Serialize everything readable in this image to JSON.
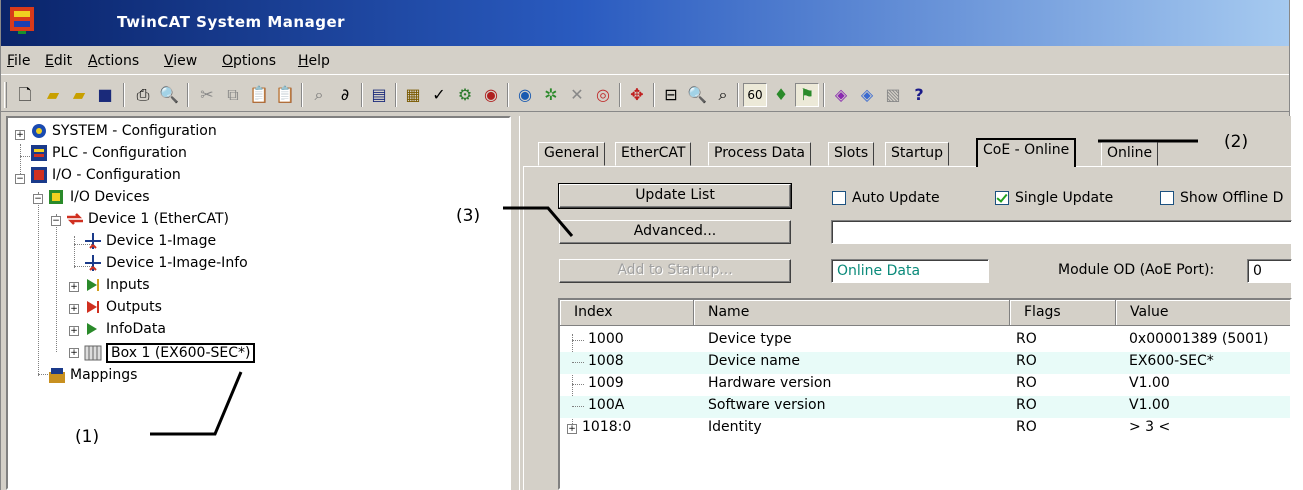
{
  "window": {
    "title": "TwinCAT System Manager"
  },
  "menu": [
    {
      "label": "File",
      "u": "F",
      "rest": "ile"
    },
    {
      "label": "Edit",
      "u": "E",
      "rest": "dit"
    },
    {
      "label": "Actions",
      "u": "A",
      "rest": "ctions"
    },
    {
      "label": "View",
      "u": "V",
      "rest": "iew"
    },
    {
      "label": "Options",
      "u": "O",
      "rest": "ptions"
    },
    {
      "label": "Help",
      "u": "H",
      "rest": "elp"
    }
  ],
  "tree": {
    "system": "SYSTEM - Configuration",
    "plc": "PLC - Configuration",
    "io": "I/O - Configuration",
    "io_devices": "I/O Devices",
    "device1": "Device 1 (EtherCAT)",
    "image": "Device 1-Image",
    "image_info": "Device 1-Image-Info",
    "inputs": "Inputs",
    "outputs": "Outputs",
    "infodata": "InfoData",
    "box1": "Box 1 (EX600-SEC*)",
    "mappings": "Mappings"
  },
  "tabs": [
    "General",
    "EtherCAT",
    "Process Data",
    "Slots",
    "Startup",
    "CoE - Online",
    "Online"
  ],
  "active_tab": "CoE - Online",
  "coe": {
    "update_list": "Update List",
    "advanced": "Advanced...",
    "add_to_startup": "Add to Startup...",
    "auto_update": "Auto Update",
    "single_update": "Single Update",
    "show_offline": "Show Offline D",
    "online_data": "Online Data",
    "module_od_label": "Module OD (AoE Port):",
    "module_od_value": "0",
    "auto_update_checked": false,
    "single_update_checked": true,
    "show_offline_checked": false
  },
  "table": {
    "headers": [
      "Index",
      "Name",
      "Flags",
      "Value"
    ],
    "rows": [
      {
        "index": "1000",
        "name": "Device type",
        "flags": "RO",
        "value": "0x00001389 (5001)"
      },
      {
        "index": "1008",
        "name": "Device name",
        "flags": "RO",
        "value": "EX600-SEC*"
      },
      {
        "index": "1009",
        "name": "Hardware version",
        "flags": "RO",
        "value": "V1.00"
      },
      {
        "index": "100A",
        "name": "Software version",
        "flags": "RO",
        "value": "V1.00"
      },
      {
        "index": "1018:0",
        "name": "Identity",
        "flags": "RO",
        "value": "> 3 <"
      }
    ]
  },
  "annotations": {
    "a1": "(1)",
    "a2": "(2)",
    "a3": "(3)"
  },
  "colors": {
    "title_start": "#0a246a",
    "title_end": "#a6caf0",
    "row_alt": "#e8fbf8",
    "face": "#d4d0c8"
  }
}
